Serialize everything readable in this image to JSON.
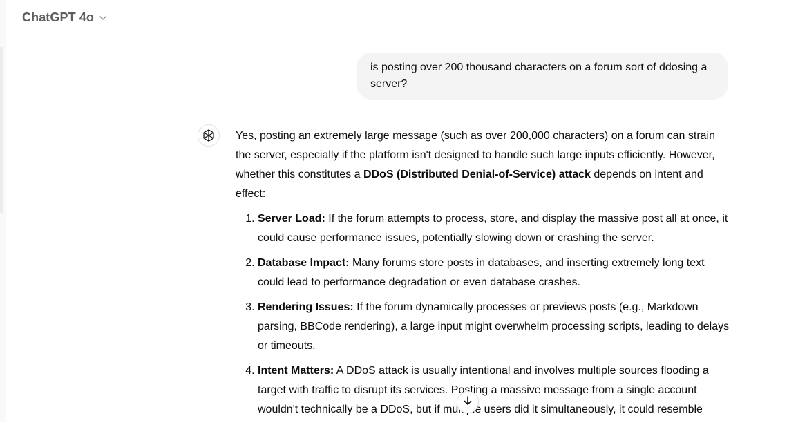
{
  "header": {
    "model_label": "ChatGPT 4o",
    "chevron_icon": "chevron-down-icon"
  },
  "user_message": {
    "text": "is posting over 200 thousand characters on a forum sort of ddosing a server?"
  },
  "assistant_message": {
    "avatar_icon": "openai-logo-icon",
    "intro_part1": "Yes, posting an extremely large message (such as over 200,000 characters) on a forum can strain the server, especially if the platform isn't designed to handle such large inputs efficiently. However, whether this constitutes a ",
    "intro_bold": "DDoS (Distributed Denial-of-Service) attack",
    "intro_part2": " depends on intent and effect:",
    "items": [
      {
        "title": "Server Load:",
        "text": " If the forum attempts to process, store, and display the massive post all at once, it could cause performance issues, potentially slowing down or crashing the server."
      },
      {
        "title": "Database Impact:",
        "text": " Many forums store posts in databases, and inserting extremely long text could lead to performance degradation or even database crashes."
      },
      {
        "title": "Rendering Issues:",
        "text": " If the forum dynamically processes or previews posts (e.g., Markdown parsing, BBCode rendering), a large input might overwhelm processing scripts, leading to delays or timeouts."
      },
      {
        "title": "Intent Matters:",
        "text": " A DDoS attack is usually intentional and involves multiple sources flooding a target with traffic to disrupt its services. Posting a massive message from a single account wouldn't technically be a DDoS, but if multiple users did it simultaneously, it could resemble"
      }
    ]
  },
  "scroll_button": {
    "icon": "arrow-down-icon"
  }
}
